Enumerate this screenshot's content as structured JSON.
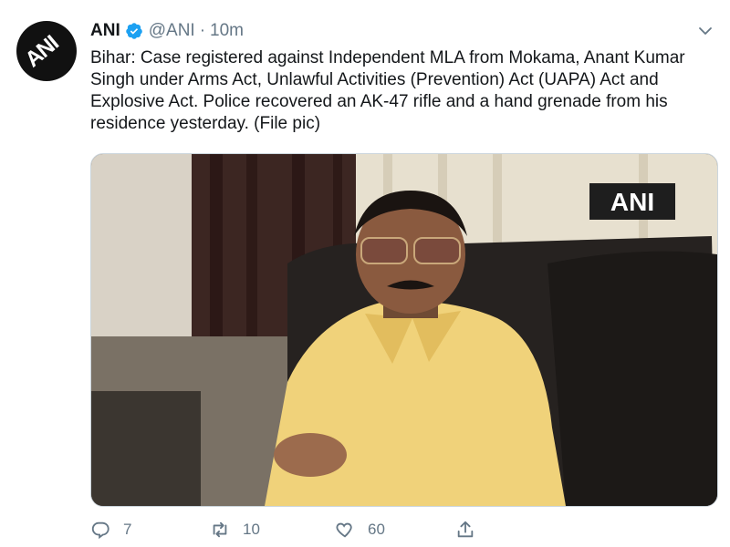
{
  "tweet": {
    "author_name": "ANI",
    "handle": "@ANI",
    "separator": "·",
    "time": "10m",
    "avatar_text": "ANI",
    "text": "Bihar: Case registered against Independent MLA from Mokama, Anant Kumar Singh under Arms Act, Unlawful Activities (Prevention) Act (UAPA) Act and Explosive Act. Police recovered an AK-47 rifle and a hand grenade from his residence yesterday. (File pic)",
    "media_watermark": "ANI"
  },
  "actions": {
    "reply_count": "7",
    "retweet_count": "10",
    "like_count": "60"
  },
  "colors": {
    "verified": "#1da1f2",
    "muted": "#657786",
    "shirt": "#f0d27a"
  },
  "icons": [
    "verified-badge-icon",
    "chevron-down-icon",
    "reply-icon",
    "retweet-icon",
    "like-icon",
    "share-icon"
  ]
}
